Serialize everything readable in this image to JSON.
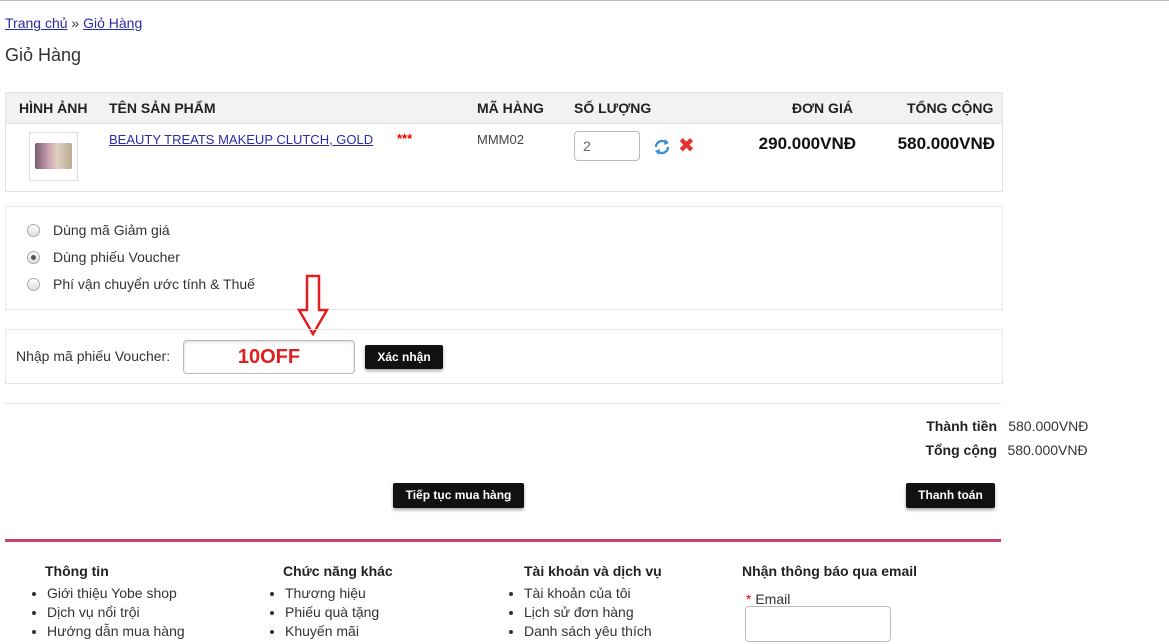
{
  "breadcrumb": {
    "home": "Trang chủ",
    "sep": "»",
    "current": "Giỏ Hàng"
  },
  "page_title": "Giỏ Hàng",
  "cart": {
    "headers": {
      "image": "HÌNH ẢNH",
      "name": "TÊN SẢN PHẨM",
      "sku": "MÃ HÀNG",
      "qty": "SỐ LƯỢNG",
      "unit_price": "ĐƠN GIÁ",
      "total": "TỔNG CỘNG"
    },
    "item": {
      "name": "BEAUTY TREATS MAKEUP CLUTCH, GOLD",
      "stars": "***",
      "sku": "MMM02",
      "qty": "2",
      "unit_price": "290.000VNĐ",
      "total": "580.000VNĐ"
    }
  },
  "options": [
    {
      "label": "Dùng mã Giảm giá",
      "selected": false
    },
    {
      "label": "Dùng phiếu Voucher",
      "selected": true
    },
    {
      "label": "Phí vận chuyển ước tính & Thuế",
      "selected": false
    }
  ],
  "voucher": {
    "label": "Nhập mã phiếu Voucher:",
    "value": "10OFF",
    "button": "Xác nhận"
  },
  "totals": {
    "subtotal_label": "Thành tiền",
    "subtotal": "580.000VNĐ",
    "total_label": "Tổng cộng",
    "total": "580.000VNĐ"
  },
  "buttons": {
    "continue": "Tiếp tục mua hàng",
    "checkout": "Thanh toán"
  },
  "footer": {
    "col1": {
      "title": "Thông tin",
      "items": [
        "Giới thiệu Yobe shop",
        "Dịch vụ nổi trội",
        "Hướng dẫn mua hàng"
      ]
    },
    "col2": {
      "title": "Chức năng khác",
      "items": [
        "Thương hiệu",
        "Phiếu quà tặng",
        "Khuyến mãi"
      ]
    },
    "col3": {
      "title": "Tài khoản và dịch vụ",
      "items": [
        "Tài khoản của tôi",
        "Lịch sử đơn hàng",
        "Danh sách yêu thích"
      ]
    },
    "col4": {
      "title": "Nhận thông báo qua email",
      "email_label": "Email",
      "required_mark": "*"
    }
  },
  "colors": {
    "link": "#2b2ba5",
    "accent_line": "#c8456a",
    "arrow": "#e02020",
    "voucher_text": "#e02020"
  },
  "icons": [
    "refresh-icon",
    "remove-icon",
    "down-arrow-icon"
  ]
}
